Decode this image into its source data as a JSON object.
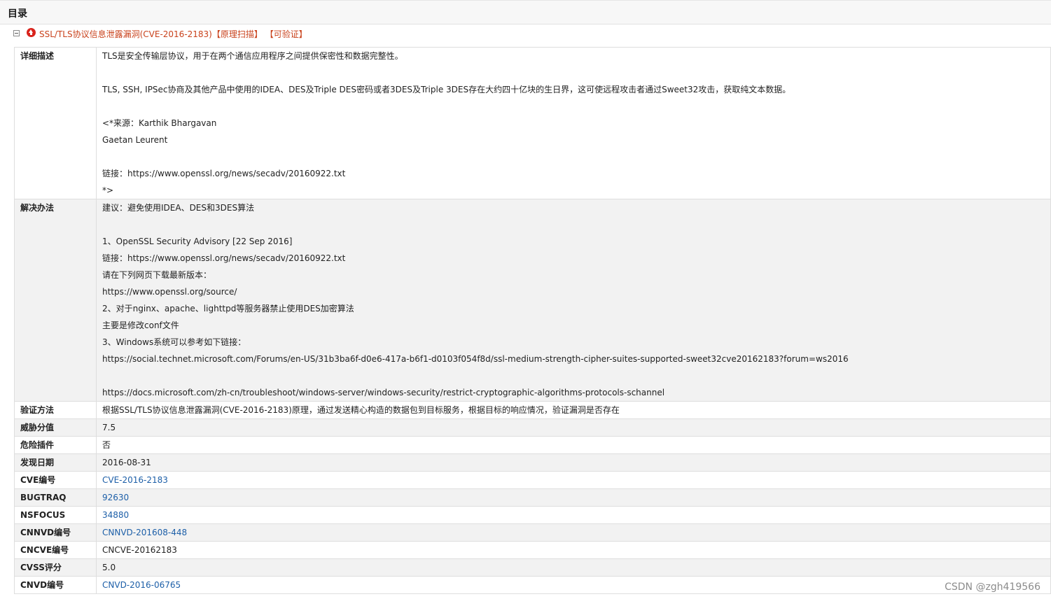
{
  "header": {
    "title": "目录"
  },
  "vuln": {
    "name": "SSL/TLS协议信息泄露漏洞(CVE-2016-2183)",
    "tag1": "【原理扫描】",
    "tag2": "【可验证】"
  },
  "details": {
    "description": {
      "label": "详细描述",
      "l1": "TLS是安全传输层协议，用于在两个通信应用程序之间提供保密性和数据完整性。",
      "l2": "TLS, SSH, IPSec协商及其他产品中使用的IDEA、DES及Triple DES密码或者3DES及Triple 3DES存在大约四十亿块的生日界，这可使远程攻击者通过Sweet32攻击，获取纯文本数据。",
      "l3": "<*来源：Karthik Bhargavan",
      "l4": "Gaetan Leurent",
      "l5": "链接：https://www.openssl.org/news/secadv/20160922.txt",
      "l6": "*>"
    },
    "solution": {
      "label": "解决办法",
      "l1": "建议：避免使用IDEA、DES和3DES算法",
      "l2": "1、OpenSSL Security Advisory [22 Sep 2016]",
      "l3": "链接：https://www.openssl.org/news/secadv/20160922.txt",
      "l4": "请在下列网页下载最新版本：",
      "l5": "https://www.openssl.org/source/",
      "l6": "2、对于nginx、apache、lighttpd等服务器禁止使用DES加密算法",
      "l7": "主要是修改conf文件",
      "l8": "3、Windows系统可以参考如下链接：",
      "l9": "https://social.technet.microsoft.com/Forums/en-US/31b3ba6f-d0e6-417a-b6f1-d0103f054f8d/ssl-medium-strength-cipher-suites-supported-sweet32cve20162183?forum=ws2016",
      "l10": "https://docs.microsoft.com/zh-cn/troubleshoot/windows-server/windows-security/restrict-cryptographic-algorithms-protocols-schannel"
    },
    "verify": {
      "label": "验证方法",
      "value": "根据SSL/TLS协议信息泄露漏洞(CVE-2016-2183)原理，通过发送精心构造的数据包到目标服务，根据目标的响应情况，验证漏洞是否存在"
    },
    "threat": {
      "label": "威胁分值",
      "value": "7.5"
    },
    "plugin": {
      "label": "危险插件",
      "value": "否"
    },
    "date": {
      "label": "发现日期",
      "value": "2016-08-31"
    },
    "cve": {
      "label": "CVE编号",
      "value": "CVE-2016-2183"
    },
    "bugtraq": {
      "label": "BUGTRAQ",
      "value": "92630"
    },
    "nsfocus": {
      "label": "NSFOCUS",
      "value": "34880"
    },
    "cnnvd": {
      "label": "CNNVD编号",
      "value": "CNNVD-201608-448"
    },
    "cncve": {
      "label": "CNCVE编号",
      "value": "CNCVE-20162183"
    },
    "cvss": {
      "label": "CVSS评分",
      "value": "5.0"
    },
    "cnvd": {
      "label": "CNVD编号",
      "value": "CNVD-2016-06765"
    }
  },
  "watermark": "CSDN @zgh419566",
  "colors": {
    "accent": "#c9421c",
    "link": "#1d5fa8",
    "risk": "#d9231c",
    "row_alt": "#f2f2f2"
  }
}
